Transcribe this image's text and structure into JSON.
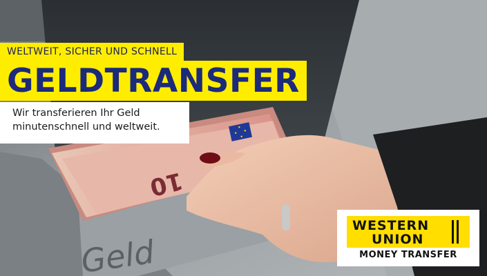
{
  "banner": {
    "tagline": "WELTWEIT, SICHER UND SCHNELL",
    "headline": "GELDTRANSFER",
    "subtitle_line1": "Wir transferieren Ihr Geld",
    "subtitle_line2": "minutenschnell und weltweit."
  },
  "logo": {
    "brand_line1": "WESTERN",
    "brand_line2": "UNION",
    "caption": "MONEY TRANSFER"
  },
  "photo": {
    "atm_label": "Geld",
    "banknote_value": "10"
  },
  "colors": {
    "accent_yellow": "#ffed00",
    "headline_blue": "#1b2a7a",
    "logo_yellow": "#ffde00"
  }
}
